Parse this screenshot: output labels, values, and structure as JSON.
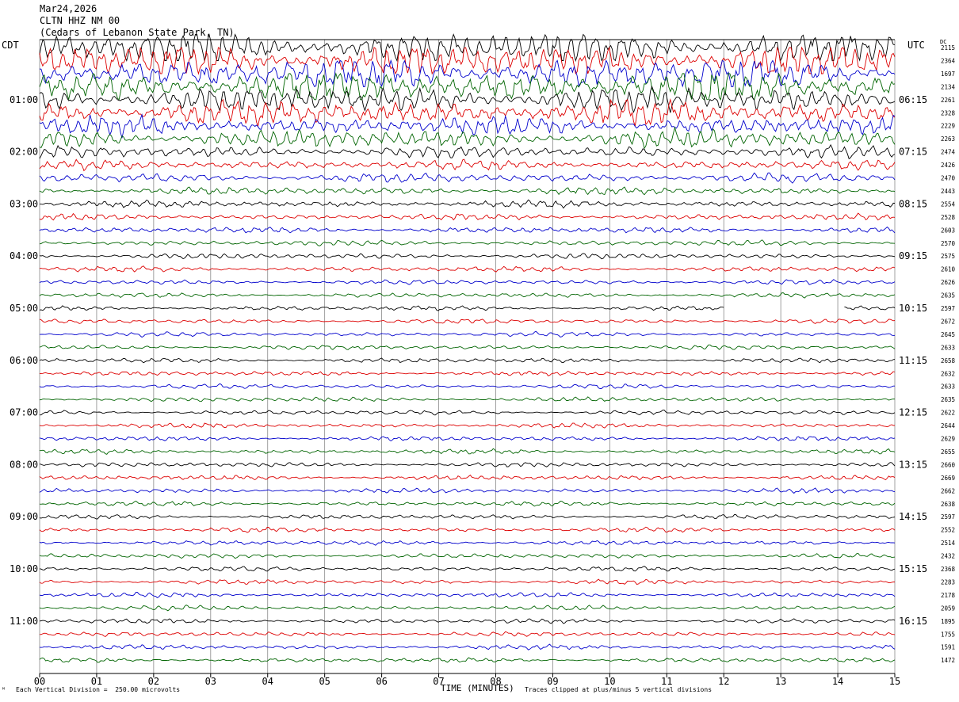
{
  "header": {
    "date": "Mar24,2026",
    "channel": "CLTN HHZ NM 00",
    "location": "(Cedars of Lebanon State Park, TN)"
  },
  "corner_labels": {
    "left": "CDT",
    "right": "UTC",
    "dc": "DC"
  },
  "footer": {
    "scale_note": "Each Vertical Division =  250.00 microvolts",
    "clip_note": "Traces clipped at plus/minus 5 vertical divisions",
    "logo_mark": "ᴹ"
  },
  "colors": {
    "black": "#000000",
    "red": "#dd0000",
    "blue": "#0000cc",
    "green": "#006400",
    "grid": "#888888"
  },
  "chart_data": {
    "type": "line",
    "xlabel": "TIME (MINUTES)",
    "xlim": [
      0,
      15
    ],
    "x_ticks": [
      "00",
      "01",
      "02",
      "03",
      "04",
      "05",
      "06",
      "07",
      "08",
      "09",
      "10",
      "11",
      "12",
      "13",
      "14",
      "15"
    ],
    "left_hour_labels": [
      "01:00",
      "02:00",
      "03:00",
      "04:00",
      "05:00",
      "06:00",
      "07:00",
      "08:00",
      "09:00",
      "10:00",
      "11:00"
    ],
    "right_hour_labels": [
      "06:15",
      "07:15",
      "08:15",
      "09:15",
      "10:15",
      "11:15",
      "12:15",
      "13:15",
      "14:15",
      "15:15",
      "16:15"
    ],
    "trace_colors_cycle": [
      "black",
      "red",
      "blue",
      "green"
    ],
    "trace_dc_offsets": [
      2115,
      2364,
      1697,
      2134,
      2261,
      2328,
      2229,
      2263,
      2474,
      2426,
      2470,
      2443,
      2554,
      2528,
      2603,
      2570,
      2575,
      2610,
      2626,
      2635,
      2597,
      2672,
      2645,
      2633,
      2658,
      2632,
      2633,
      2635,
      2622,
      2644,
      2629,
      2655,
      2660,
      2669,
      2662,
      2638,
      2597,
      2552,
      2514,
      2432,
      2368,
      2283,
      2178,
      2059,
      1895,
      1755,
      1591,
      1472
    ],
    "trace_amplitude_divisions": [
      4.5,
      4.5,
      4.5,
      4.5,
      3.5,
      3.5,
      2.5,
      2.5,
      1.6,
      1.3,
      1.2,
      1.0,
      0.9,
      0.8,
      0.8,
      0.7,
      0.7,
      0.7,
      0.6,
      0.6,
      0.6,
      0.6,
      0.6,
      0.6,
      0.6,
      0.6,
      0.6,
      0.6,
      0.6,
      0.6,
      0.6,
      0.6,
      0.6,
      0.6,
      0.6,
      0.6,
      0.6,
      0.6,
      0.6,
      0.6,
      0.6,
      0.6,
      0.6,
      0.6,
      0.6,
      0.6,
      0.6,
      0.6
    ],
    "clip_divisions": 5,
    "gap": {
      "trace_index": 20,
      "minutes": [
        12.0,
        14.1
      ]
    }
  }
}
